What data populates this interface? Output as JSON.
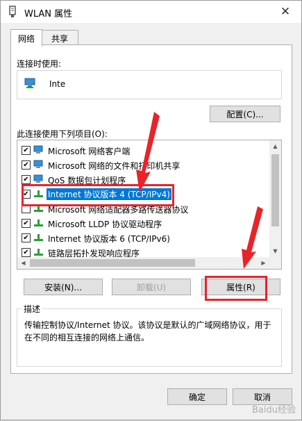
{
  "window": {
    "title": "WLAN 属性",
    "close_glyph": "✕"
  },
  "tabs": [
    {
      "label": "网络"
    },
    {
      "label": "共享"
    }
  ],
  "connect_using": {
    "label": "连接时使用:",
    "adapter_name": "Inte",
    "configure_button": "配置(C)..."
  },
  "items_label": "此连接使用下列项目(O):",
  "items": [
    {
      "label": "Microsoft 网络客户端",
      "checked": true,
      "icon": "network-client-icon"
    },
    {
      "label": "Microsoft 网络的文件和打印机共享",
      "checked": true,
      "icon": "file-share-icon"
    },
    {
      "label": "QoS 数据包计划程序",
      "checked": true,
      "icon": "qos-icon"
    },
    {
      "label": "Internet 协议版本 4 (TCP/IPv4)",
      "checked": true,
      "icon": "protocol-icon",
      "selected": true
    },
    {
      "label": "Microsoft 网络适配器多路传送器协议",
      "checked": false,
      "icon": "protocol-icon"
    },
    {
      "label": "Microsoft LLDP 协议驱动程序",
      "checked": true,
      "icon": "protocol-icon"
    },
    {
      "label": "Internet 协议版本 6 (TCP/IPv6)",
      "checked": true,
      "icon": "protocol-icon"
    },
    {
      "label": "链路层拓扑发现响应程序",
      "checked": true,
      "icon": "protocol-icon"
    }
  ],
  "buttons": {
    "install": "安装(N)...",
    "uninstall": "卸载(U)",
    "properties": "属性(R)"
  },
  "description": {
    "title": "描述",
    "text": "传输控制协议/Internet 协议。该协议是默认的广域网络协议，用于在不同的相互连接的网络上通信。"
  },
  "footer": {
    "ok": "确定",
    "cancel": "取消"
  },
  "watermark": "Baidu经验",
  "annotation_color": "#e8232a"
}
